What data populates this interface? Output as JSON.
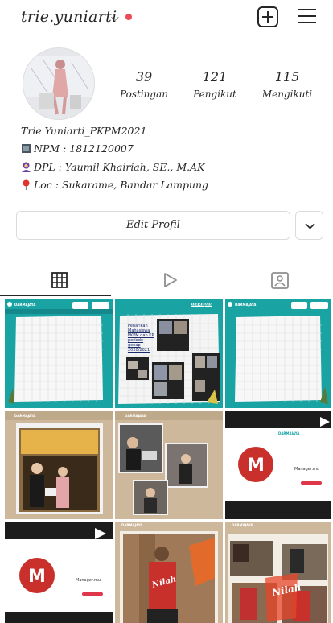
{
  "header": {
    "username": "trie.yuniarti",
    "new_post_icon": "plus-square-icon",
    "menu_icon": "hamburger-icon"
  },
  "stats": [
    {
      "value": "39",
      "label": "Postingan"
    },
    {
      "value": "121",
      "label": "Pengikut"
    },
    {
      "value": "115",
      "label": "Mengikuti"
    }
  ],
  "bio": {
    "name": "Trie Yuniarti_PKPM2021",
    "line1": "NPM : 1812120007",
    "line2": "DPL : Yaumil Khairiah, SE., M.AK",
    "line3": "Loc : Sukarame, Bandar Lampung"
  },
  "buttons": {
    "edit_profile": "Edit Profil"
  },
  "tabs": [
    "grid-icon",
    "reels-icon",
    "tagged-icon"
  ],
  "posts": [
    {
      "brand": "DARMAJAYA",
      "text": ""
    },
    {
      "brand": "DARMAJAYA",
      "text": "Penarikan Mahasiswa PKPM dan KP periode genap 2020/2021"
    },
    {
      "brand": "DARMAJAYA",
      "text": ""
    },
    {
      "brand": "DARMAJAYA",
      "text": ""
    },
    {
      "brand": "DARMAJAYA",
      "text": ""
    },
    {
      "brand": "DARMAJAYA",
      "text": "Manager.mu"
    },
    {
      "brand": "",
      "text": "Manager.mu"
    },
    {
      "brand": "DARMAJAYA",
      "text": "Nilah"
    },
    {
      "brand": "DARMAJAYA",
      "text": "Nilah"
    }
  ],
  "colors": {
    "teal": "#1aa3a3",
    "red_dot": "#ed4956",
    "beige": "#cdb89c",
    "dark": "#262626"
  }
}
